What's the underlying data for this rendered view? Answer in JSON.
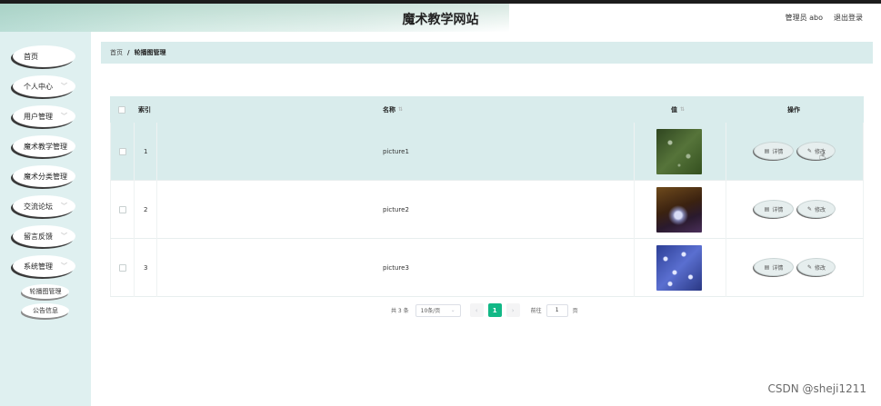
{
  "header": {
    "site_title": "魔术教学网站",
    "user_label": "管理员 abo",
    "logout_label": "退出登录"
  },
  "sidebar": {
    "items": [
      {
        "label": "首页",
        "has_chevron": false
      },
      {
        "label": "个人中心",
        "has_chevron": true
      },
      {
        "label": "用户管理",
        "has_chevron": true
      },
      {
        "label": "魔术教学管理",
        "has_chevron": true
      },
      {
        "label": "魔术分类管理",
        "has_chevron": true
      },
      {
        "label": "交流论坛",
        "has_chevron": true
      },
      {
        "label": "留言反馈",
        "has_chevron": true
      },
      {
        "label": "系统管理",
        "has_chevron": true
      }
    ],
    "sub_items": [
      {
        "label": "轮播图管理"
      },
      {
        "label": "公告信息"
      }
    ]
  },
  "breadcrumb": {
    "home": "首页",
    "separator": "/",
    "current": "轮播图管理"
  },
  "table": {
    "columns": {
      "index": "索引",
      "name": "名称",
      "value": "值",
      "action": "操作"
    },
    "rows": [
      {
        "index": "1",
        "name": "picture1",
        "thumb_colors": [
          "#3e5a2a",
          "#d9e6d0"
        ],
        "highlighted": true
      },
      {
        "index": "2",
        "name": "picture2",
        "thumb_colors": [
          "#5a3a12",
          "#c7d2f0"
        ],
        "highlighted": false
      },
      {
        "index": "3",
        "name": "picture3",
        "thumb_colors": [
          "#2d3f96",
          "#c7d2f0"
        ],
        "highlighted": false
      }
    ],
    "detail_label": "详情",
    "edit_label": "修改"
  },
  "pagination": {
    "total": "共 3 条",
    "page_size": "10条/页",
    "prev": "‹",
    "current_page": "1",
    "next": "›",
    "goto_prefix": "前往",
    "goto_value": "1",
    "goto_suffix": "页"
  },
  "watermark": "CSDN @sheji1211",
  "colors": {
    "accent": "#12b886",
    "panel": "#d9ecec",
    "sidebar": "#dff0f0"
  }
}
